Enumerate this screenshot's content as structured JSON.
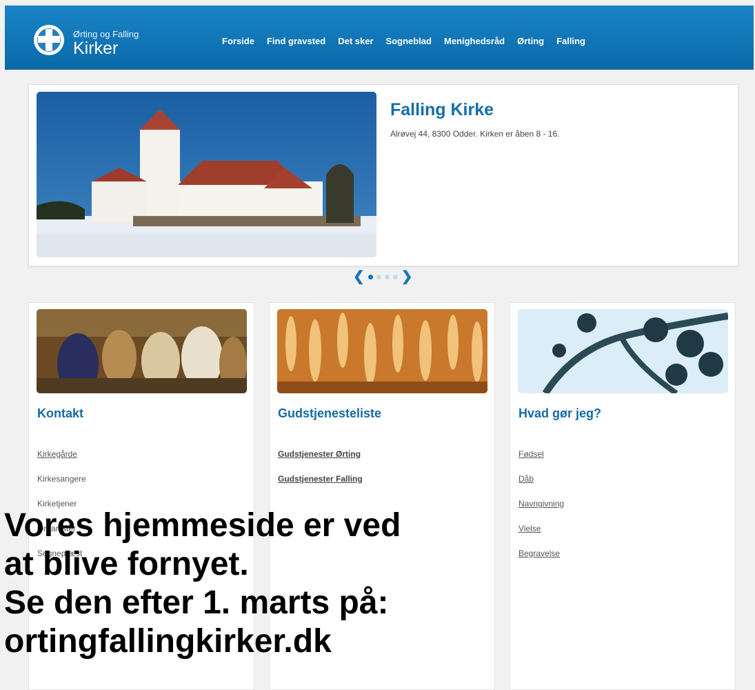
{
  "header": {
    "logo_small": "Ørting og  Falling",
    "logo_big": "Kirker",
    "nav": [
      "Forside",
      "Find gravsted",
      "Det sker",
      "Sogneblad",
      "Menighedsråd",
      "Ørting",
      "Falling"
    ]
  },
  "hero": {
    "title": "Falling Kirke",
    "text": "Alrøvej 44, 8300 Odder. Kirken er åben 8 - 16."
  },
  "pager": {
    "prev": "❮",
    "next": "❯",
    "slides": 4,
    "active_index": 0
  },
  "cards": [
    {
      "title": "Kontakt",
      "links": [
        "Kirkegårde",
        "Kirkesangere",
        "Kirketjener",
        "Organister",
        "Sognepræst"
      ]
    },
    {
      "title": "Gudstjenesteliste",
      "links": [
        "Gudstjenester Ørting",
        "Gudstjenester Falling"
      ]
    },
    {
      "title": "Hvad gør jeg?",
      "links": [
        "Fødsel",
        "Dåb",
        "Navngivning",
        "Vielse",
        "Begravelse"
      ]
    }
  ],
  "overlay": {
    "line1": "Vores hjemmeside er ved",
    "line2": "at blive fornyet.",
    "line3": "Se den efter 1. marts på:",
    "line4": "ortingfallingkirker.dk"
  },
  "colors": {
    "header": "#0f76b8",
    "accent": "#146ba4",
    "background": "#f1f1f1"
  }
}
